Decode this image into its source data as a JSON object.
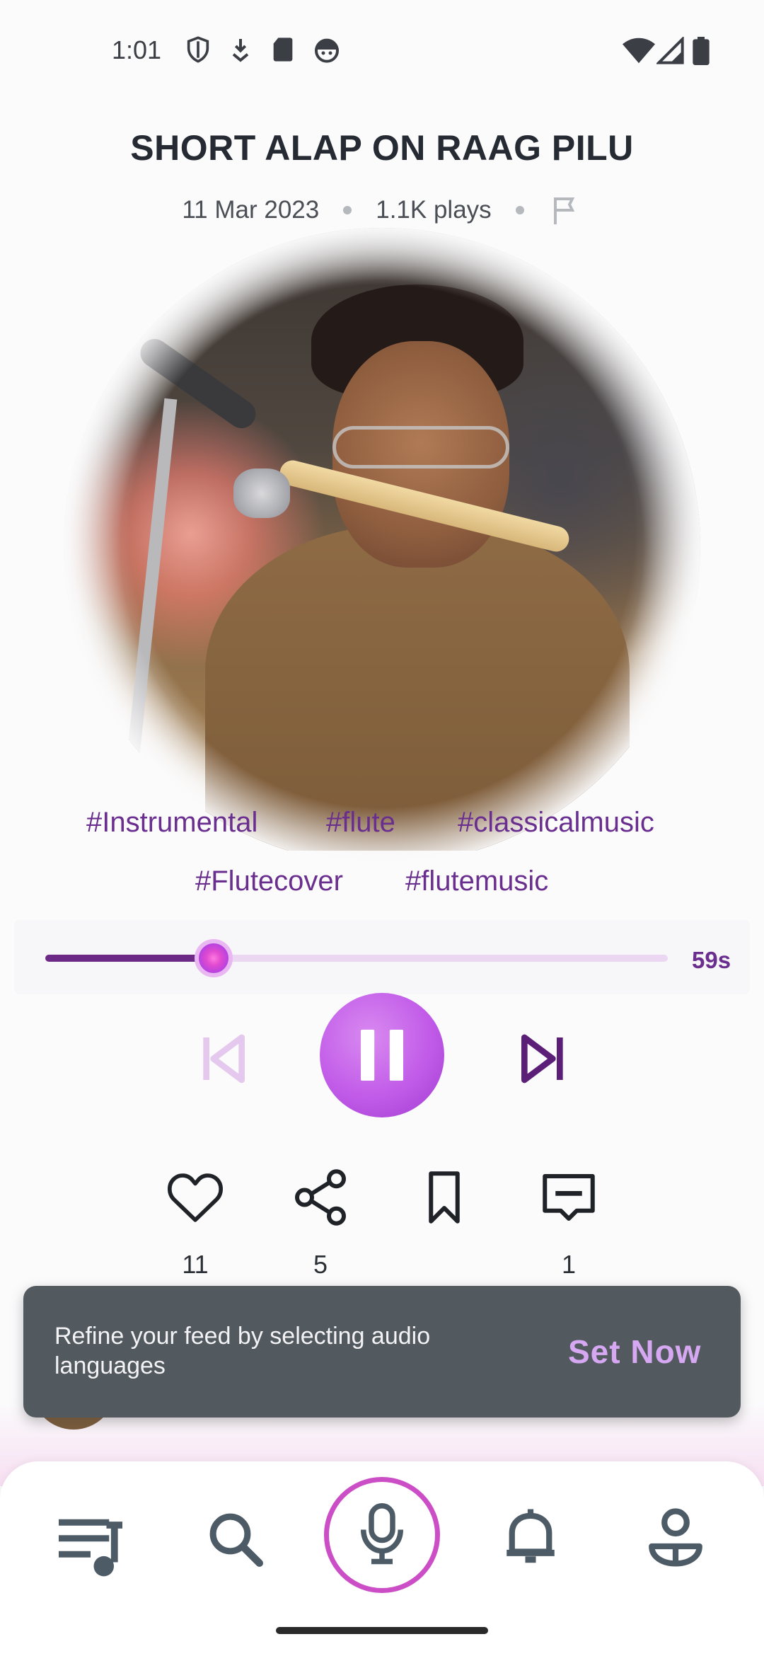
{
  "status_bar": {
    "time": "1:01",
    "left_icons": [
      "shield-icon",
      "download-icon",
      "sd-card-icon",
      "android-face-icon"
    ],
    "right_icons": [
      "wifi-icon",
      "signal-icon",
      "battery-icon"
    ]
  },
  "track": {
    "title": "SHORT ALAP ON RAAG PILU",
    "date": "11 Mar 2023",
    "plays": "1.1K plays"
  },
  "tags": [
    "#Instrumental",
    "#flute",
    "#classicalmusic",
    "#Flutecover",
    "#flutemusic"
  ],
  "player": {
    "progress": 0.27,
    "duration": "59s",
    "state": "playing"
  },
  "actions": {
    "likes": "11",
    "shares": "5",
    "comments": "1"
  },
  "snackbar": {
    "message": "Refine your feed by selecting audio languages",
    "action": "Set Now"
  },
  "bottom_nav": [
    "playlist-icon",
    "search-icon",
    "mic-icon",
    "bell-icon",
    "profile-icon"
  ],
  "colors": {
    "accent": "#6a2f8e",
    "play_gradient_start": "#d98af1",
    "play_gradient_end": "#a23bd0",
    "snackbar_bg": "#52595f",
    "snackbar_action": "#d6a8f2"
  }
}
